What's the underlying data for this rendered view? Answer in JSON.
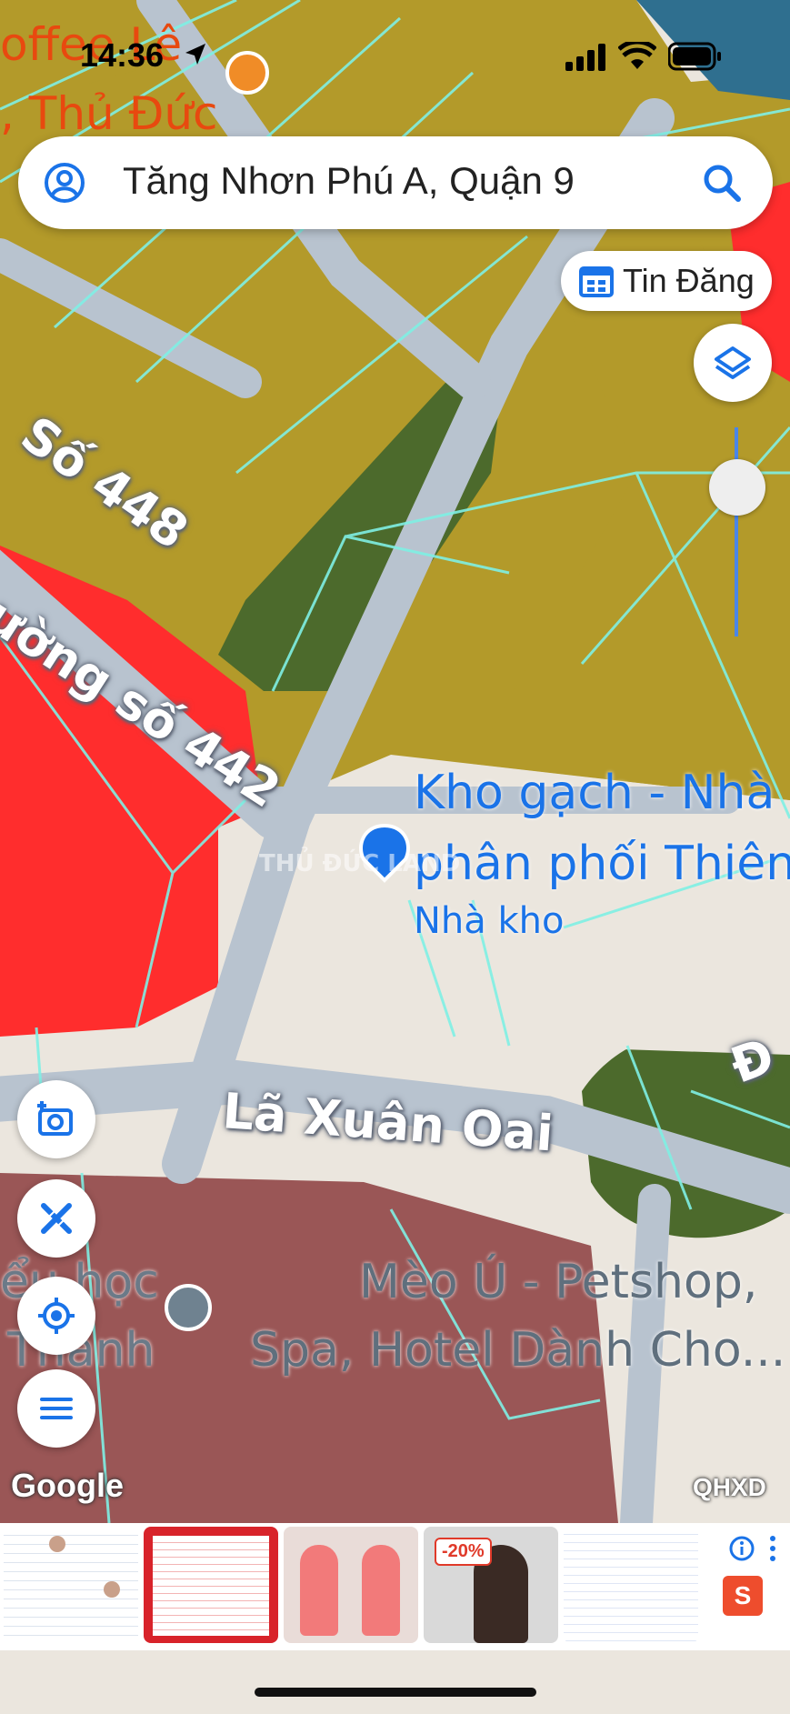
{
  "status_bar": {
    "time": "14:36"
  },
  "search": {
    "query": "Tăng Nhơn Phú A, Quận 9"
  },
  "chip": {
    "label": "Tin Đăng"
  },
  "map_labels": {
    "coffee_line1": "offee Lê",
    "coffee_line2": ", Thủ Đức",
    "road_448": "Số 448",
    "road_442": "ường số 442",
    "road_la_xuan_oai": "Lã Xuân Oai",
    "road_d": "Đ",
    "poi_kho_line1": "Kho gạch - Nhà",
    "poi_kho_line2": "phân phối Thiên",
    "poi_kho_type": "Nhà kho",
    "poi_school_line1": "ểu học",
    "poi_school_line2": "Thanh",
    "poi_petshop_line1": "Mèo Ú - Petshop,",
    "poi_petshop_line2": "Spa, Hotel Dành Cho...",
    "watermark": "THỦ ĐỨC LAND"
  },
  "attribution": {
    "google": "Google",
    "layer": "QHXD"
  },
  "ad": {
    "discount": "-20%",
    "store_letter": "S"
  },
  "colors": {
    "residential": "#b39a2a",
    "green": "#4c6a2c",
    "commercial": "#ff2d2d",
    "public": "#9a5656",
    "road": "#b8c3cf",
    "parcel_line": "#7ff0e4",
    "poi_blue": "#1a73e8"
  }
}
